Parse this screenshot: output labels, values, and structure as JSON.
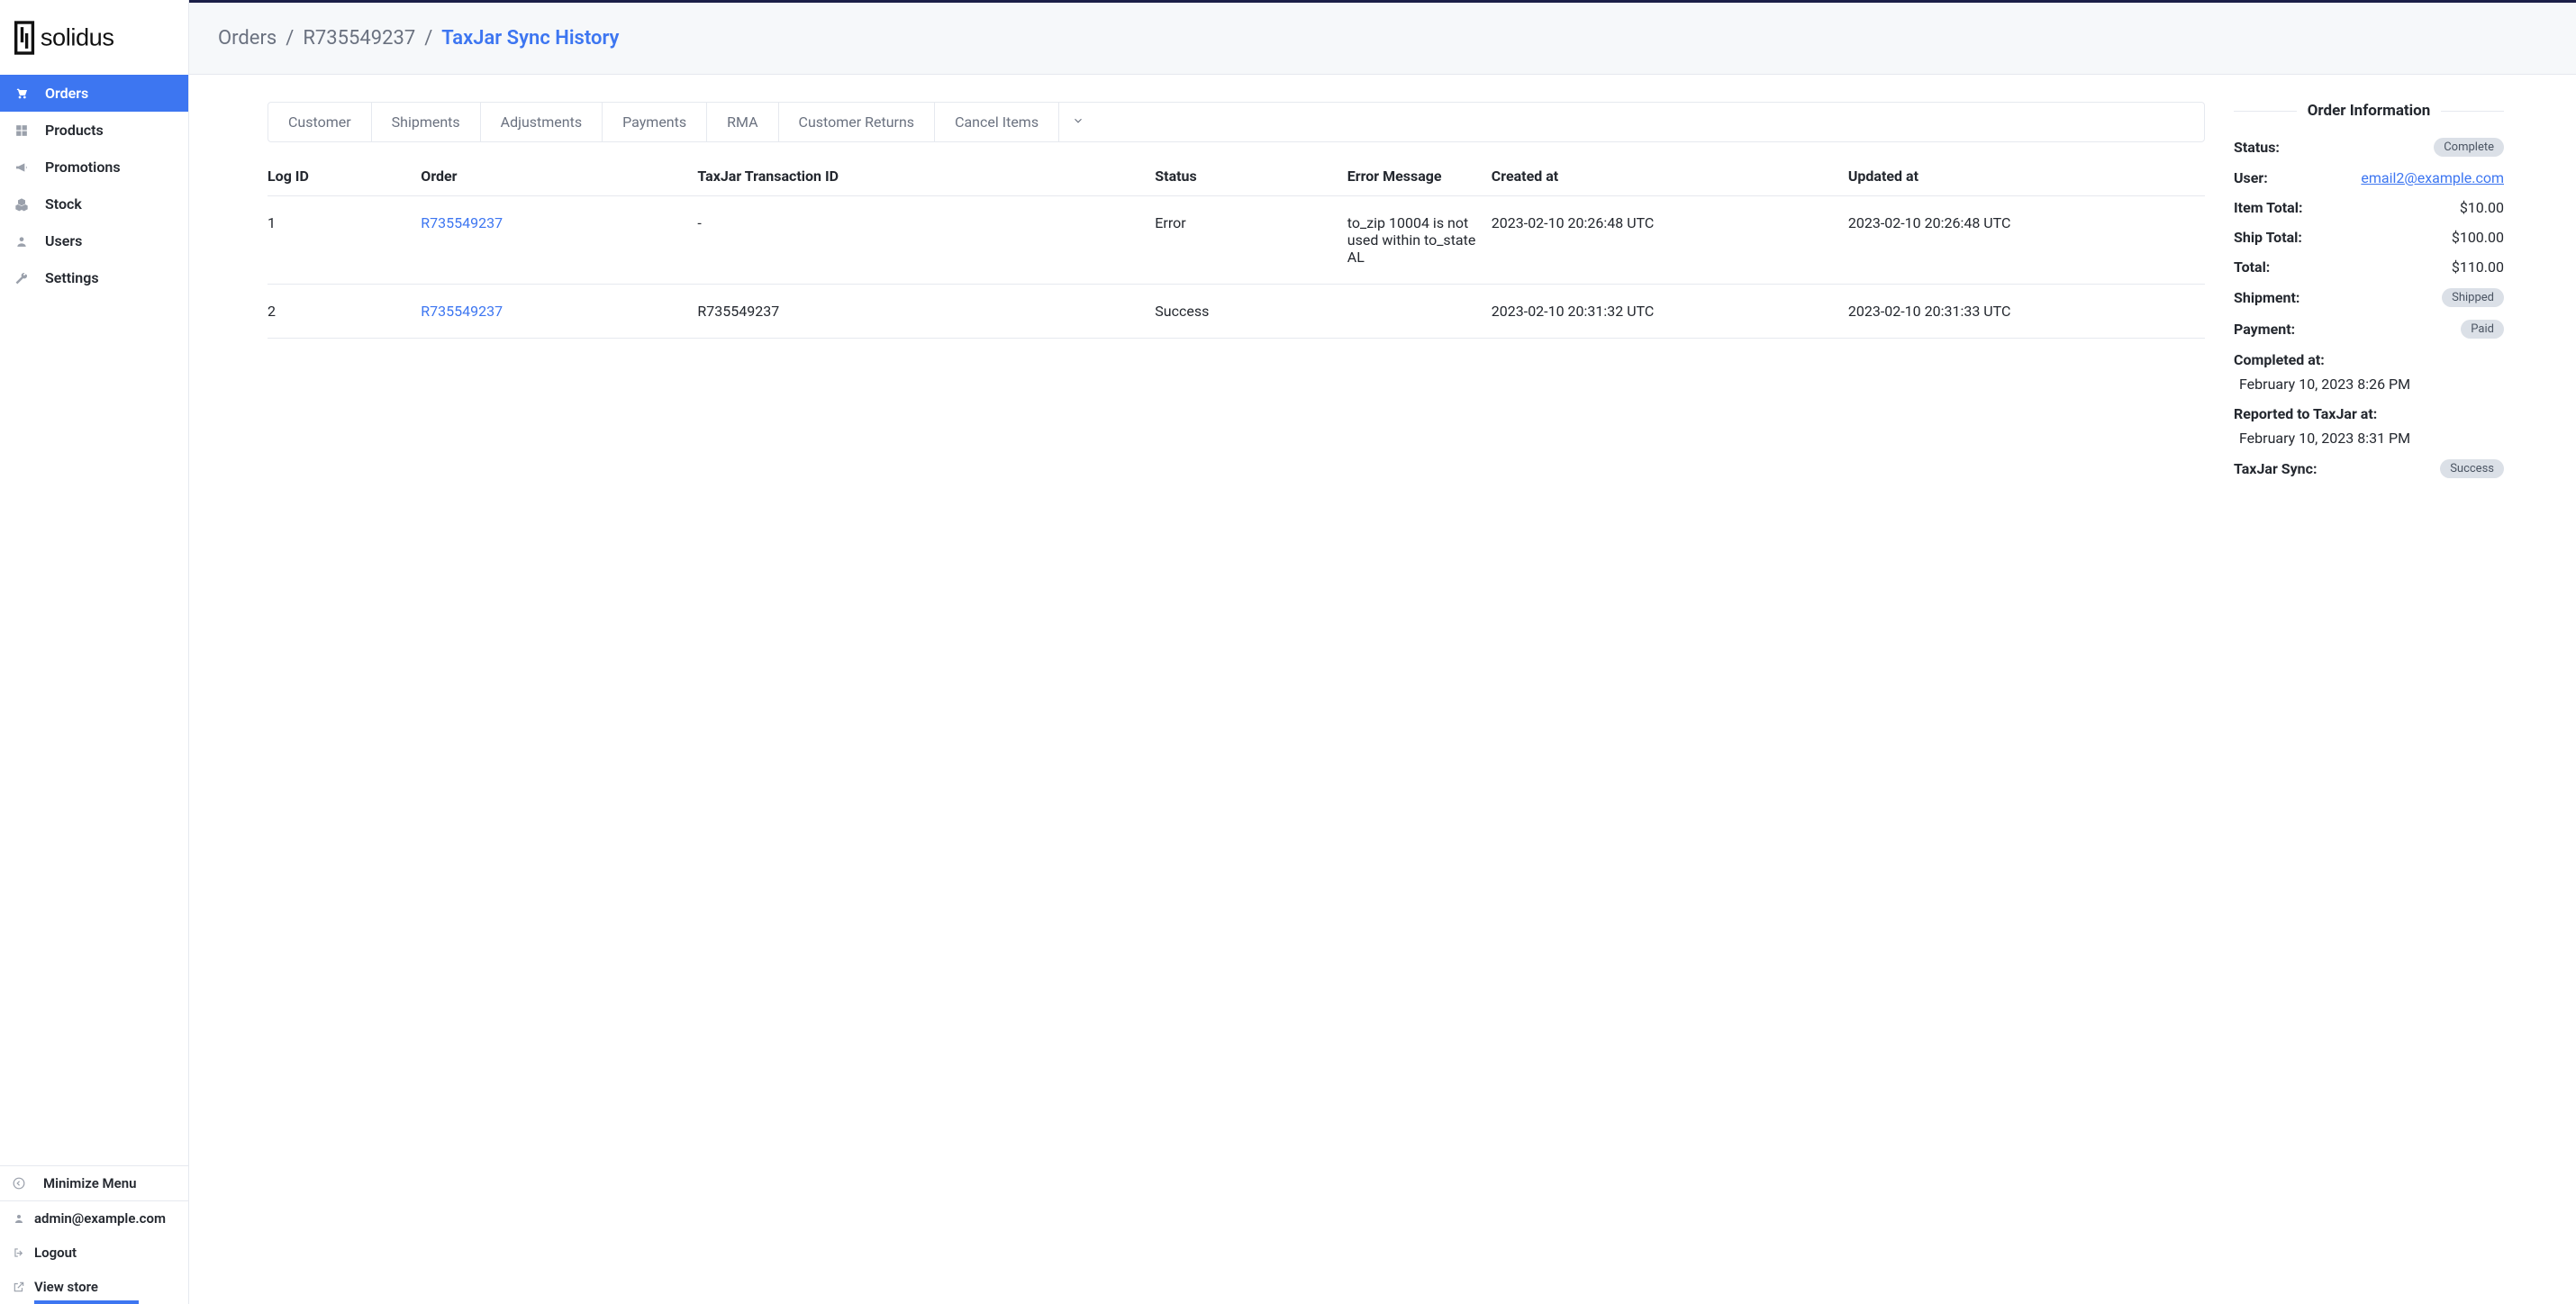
{
  "sidebar": {
    "items": [
      {
        "label": "Orders",
        "active": true,
        "icon": "cart-icon"
      },
      {
        "label": "Products",
        "active": false,
        "icon": "grid-icon"
      },
      {
        "label": "Promotions",
        "active": false,
        "icon": "bullhorn-icon"
      },
      {
        "label": "Stock",
        "active": false,
        "icon": "cubes-icon"
      },
      {
        "label": "Users",
        "active": false,
        "icon": "user-icon"
      },
      {
        "label": "Settings",
        "active": false,
        "icon": "wrench-icon"
      }
    ],
    "minimize_label": "Minimize Menu",
    "admin_email": "admin@example.com",
    "logout_label": "Logout",
    "view_store_label": "View store"
  },
  "breadcrumb": {
    "root": "Orders",
    "order": "R735549237",
    "current": "TaxJar Sync History"
  },
  "tabs": [
    {
      "label": "Customer"
    },
    {
      "label": "Shipments"
    },
    {
      "label": "Adjustments"
    },
    {
      "label": "Payments"
    },
    {
      "label": "RMA"
    },
    {
      "label": "Customer Returns"
    },
    {
      "label": "Cancel Items"
    }
  ],
  "table": {
    "headers": {
      "log_id": "Log ID",
      "order": "Order",
      "txn_id": "TaxJar Transaction ID",
      "status": "Status",
      "error": "Error Message",
      "created": "Created at",
      "updated": "Updated at"
    },
    "rows": [
      {
        "log_id": "1",
        "order": "R735549237",
        "txn_id": "-",
        "status": "Error",
        "error": "to_zip 10004 is not used within to_state AL",
        "created": "2023-02-10 20:26:48 UTC",
        "updated": "2023-02-10 20:26:48 UTC"
      },
      {
        "log_id": "2",
        "order": "R735549237",
        "txn_id": "R735549237",
        "status": "Success",
        "error": "",
        "created": "2023-02-10 20:31:32 UTC",
        "updated": "2023-02-10 20:31:33 UTC"
      }
    ]
  },
  "order_info": {
    "header": "Order Information",
    "status_label": "Status:",
    "status_value": "Complete",
    "user_label": "User:",
    "user_value": "email2@example.com",
    "item_total_label": "Item Total:",
    "item_total_value": "$10.00",
    "ship_total_label": "Ship Total:",
    "ship_total_value": "$100.00",
    "total_label": "Total:",
    "total_value": "$110.00",
    "shipment_label": "Shipment:",
    "shipment_value": "Shipped",
    "payment_label": "Payment:",
    "payment_value": "Paid",
    "completed_label": "Completed at:",
    "completed_value": "February 10, 2023 8:26 PM",
    "reported_label": "Reported to TaxJar at:",
    "reported_value": "February 10, 2023 8:31 PM",
    "sync_label": "TaxJar Sync:",
    "sync_value": "Success"
  }
}
